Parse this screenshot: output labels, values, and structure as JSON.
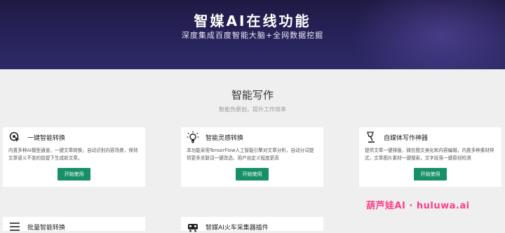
{
  "hero": {
    "title": "智媒AI在线功能",
    "subtitle": "深度集成百度智能大脑+全网数据挖掘"
  },
  "section": {
    "title": "智能写作",
    "subtitle": "智能伪原创，提升工作效率"
  },
  "cards": [
    {
      "title": "一键智能转换",
      "icon": "cursor-click-icon",
      "desc": "内置多种AI模型通道，一键文章转换，自动识别内容场景，保持文章语义不变的前提下生成新文章。",
      "button": "开始使用"
    },
    {
      "title": "智能灵感转换",
      "icon": "lightbulb-icon",
      "desc": "本功能采用TensorFlow人工智能引擎对文章分析，自动分词提供更多关联词一键改选，用户自定义程度更高",
      "button": "开始使用"
    },
    {
      "title": "自媒体写作神器",
      "icon": "desk-lamp-icon",
      "desc": "提供文章一键排版，微信图文美化和内容编辑，内置多种素材样式，文章图片素材一键搜索，文字段落一键原创检测",
      "button": "开始使用"
    },
    {
      "title": "批量智能转换",
      "icon": "list-icon"
    },
    {
      "title": "智媒AI火车采集器插件",
      "icon": "train-icon"
    }
  ],
  "watermark": "葫芦娃AI · huluwa.ai"
}
